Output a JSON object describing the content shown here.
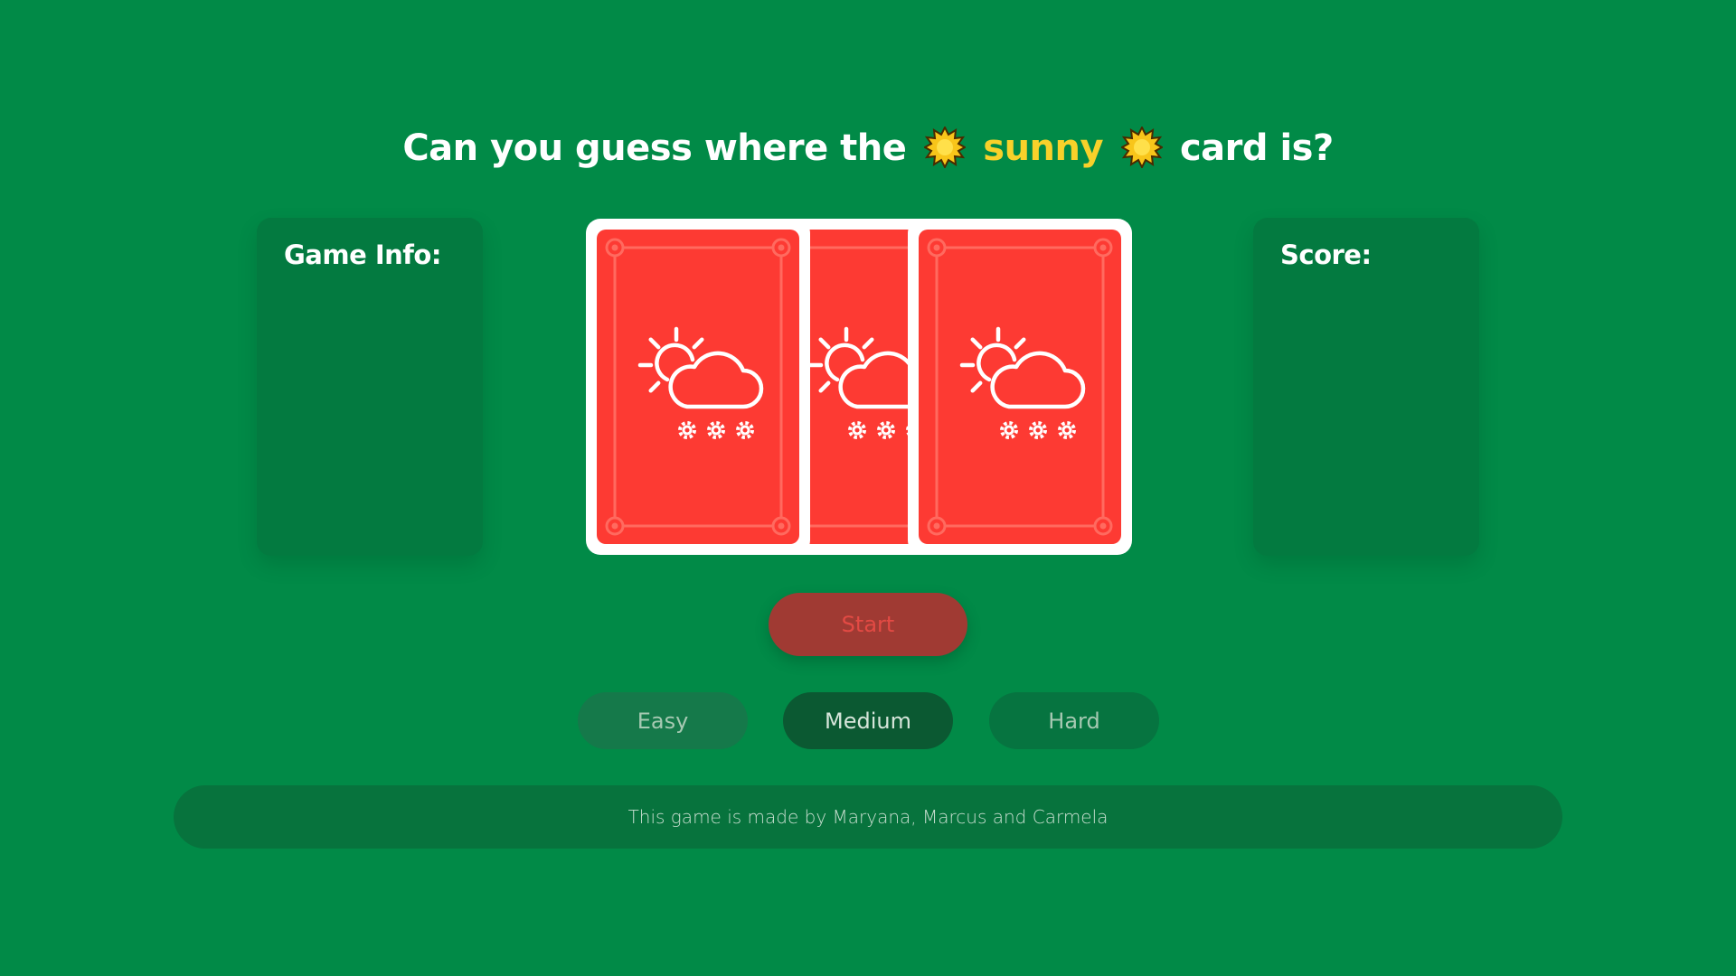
{
  "title": {
    "before": "Can you guess where the",
    "highlight": "sunny",
    "after": "card is?",
    "highlight_color": "#f8d12a",
    "sun_icon": "sun-icon"
  },
  "game_info": {
    "label": "Game Info:"
  },
  "score": {
    "label": "Score:"
  },
  "cards": [
    {
      "icon": "weather-sun-cloud-snow-icon"
    },
    {
      "icon": "weather-sun-cloud-snow-icon"
    },
    {
      "icon": "weather-sun-cloud-snow-icon"
    }
  ],
  "start_button": {
    "label": "Start"
  },
  "levels": [
    {
      "label": "Easy",
      "selected": false
    },
    {
      "label": "Medium",
      "selected": true
    },
    {
      "label": "Hard",
      "selected": false
    }
  ],
  "footer": {
    "text": "This game is made by Maryana, Marcus and Carmela"
  },
  "colors": {
    "background": "#018a47",
    "card_red": "#fd3a33",
    "panel": "#037a40"
  }
}
